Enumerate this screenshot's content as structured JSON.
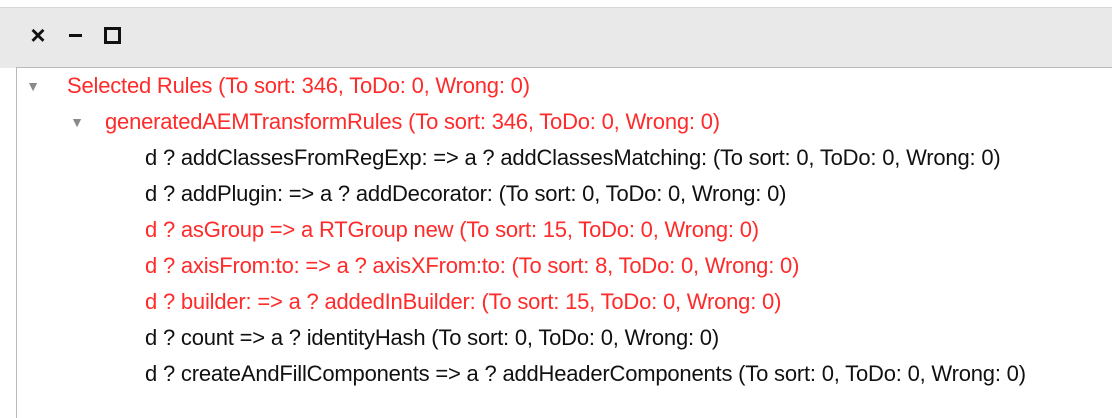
{
  "window": {
    "close_glyph": "×",
    "minimize_glyph": "–",
    "maximize_glyph": "□"
  },
  "tree": {
    "root": {
      "label": "Selected Rules (To sort: 346, ToDo: 0, Wrong: 0)",
      "expanded": true,
      "status": "red"
    },
    "group": {
      "label": "generatedAEMTransformRules (To sort: 346, ToDo: 0, Wrong: 0)",
      "expanded": true,
      "status": "red"
    },
    "rules": [
      {
        "label": "d ? addClassesFromRegExp:  => a ? addClassesMatching:  (To sort: 0, ToDo: 0, Wrong: 0)",
        "status": "black"
      },
      {
        "label": "d ? addPlugin:  => a ? addDecorator:  (To sort: 0, ToDo: 0, Wrong: 0)",
        "status": "black"
      },
      {
        "label": "d ? asGroup  => a RTGroup new  (To sort: 15, ToDo: 0, Wrong: 0)",
        "status": "red"
      },
      {
        "label": "d ? axisFrom:to:  => a ? axisXFrom:to:  (To sort: 8, ToDo: 0, Wrong: 0)",
        "status": "red"
      },
      {
        "label": "d ? builder:  => a ? addedInBuilder:  (To sort: 15, ToDo: 0, Wrong: 0)",
        "status": "red"
      },
      {
        "label": "d ? count  => a ? identityHash  (To sort: 0, ToDo: 0, Wrong: 0)",
        "status": "black"
      },
      {
        "label": "d ? createAndFillComponents  => a ? addHeaderComponents  (To sort: 0, ToDo: 0, Wrong: 0)",
        "status": "black"
      }
    ],
    "colors": {
      "red": "#ff2a2a",
      "black": "#111111",
      "toggle": "#8a8a8a"
    }
  }
}
